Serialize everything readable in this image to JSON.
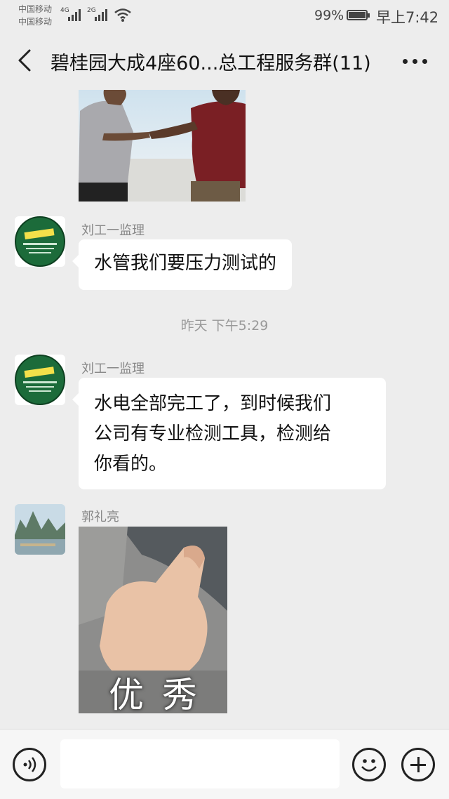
{
  "status_bar": {
    "carrier_1": "中国移动",
    "carrier_2": "中国移动",
    "network_1": "4G",
    "network_2": "2G",
    "battery_percent": "99%",
    "battery_level": 0.99,
    "time": "早上7:42"
  },
  "header": {
    "title": "碧桂园大成4座60...总工程服务群(11)",
    "back_icon": "chevron-left-icon",
    "more_icon": "more-dots-icon"
  },
  "messages": [
    {
      "type": "image",
      "image": "handshake-photo"
    },
    {
      "sender": "刘工一监理",
      "text": "水管我们要压力测试的"
    },
    {
      "type": "time",
      "text": "昨天 下午5:29"
    },
    {
      "sender": "刘工一监理",
      "lines": [
        "水电全部完工了，到时候我们",
        "公司有专业检测工具，检测给",
        "你看的。"
      ]
    },
    {
      "sender": "郭礼亮",
      "type": "sticker",
      "caption": "优秀"
    }
  ],
  "input_bar": {
    "voice_icon": "voice-icon",
    "emoji_icon": "emoji-icon",
    "plus_icon": "plus-icon"
  },
  "colors": {
    "background": "#ededed",
    "bubble": "#ffffff",
    "sender_text": "#888888",
    "avatar_green": "#1c6b3a"
  }
}
